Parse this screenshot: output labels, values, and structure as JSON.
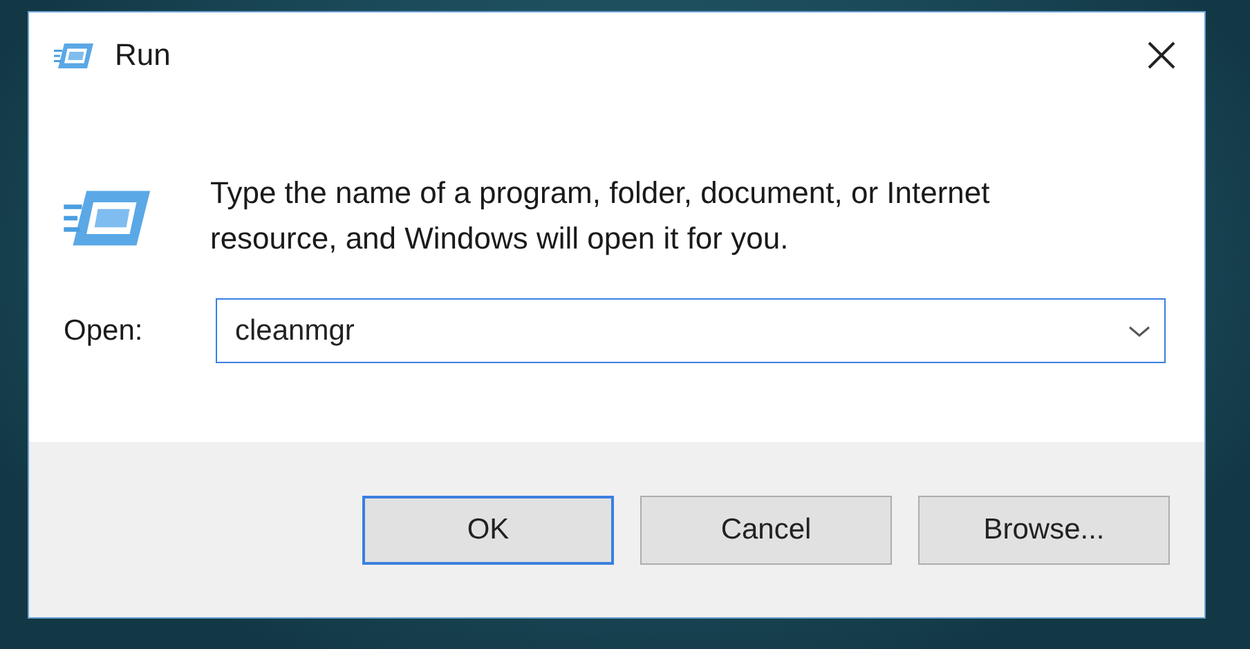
{
  "window": {
    "title": "Run"
  },
  "message": "Type the name of a program, folder, document, or Internet resource, and Windows will open it for you.",
  "open_field": {
    "label": "Open:",
    "value": "cleanmgr"
  },
  "buttons": [
    {
      "label": "OK",
      "default": true
    },
    {
      "label": "Cancel",
      "default": false
    },
    {
      "label": "Browse...",
      "default": false
    }
  ]
}
